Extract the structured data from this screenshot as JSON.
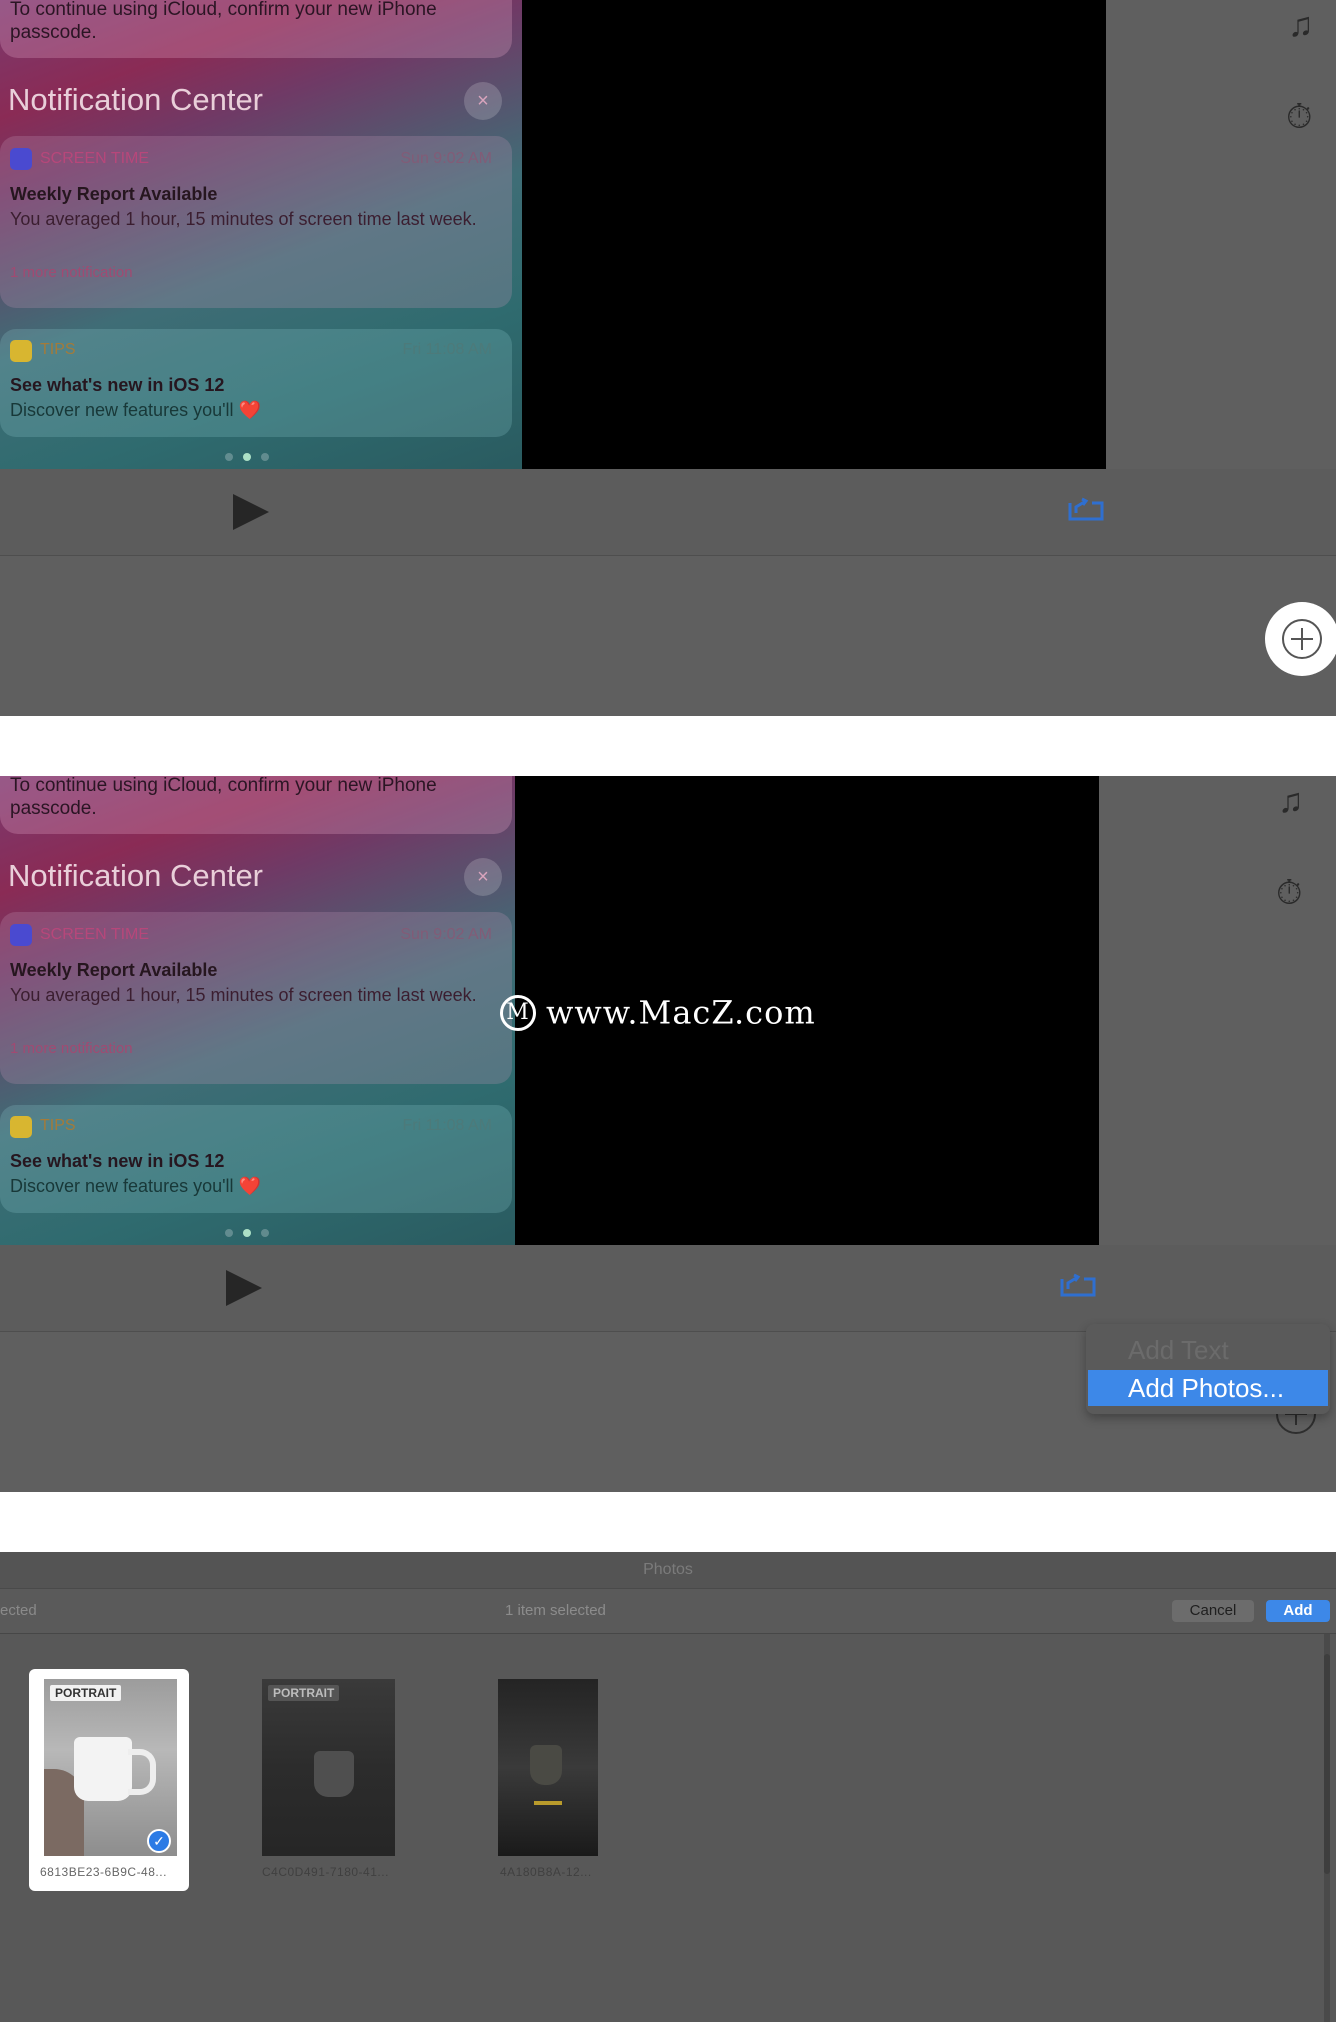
{
  "notification": {
    "top_text": "To continue using iCloud, confirm your new iPhone passcode.",
    "center_title": "Notification Center",
    "close_glyph": "×",
    "cards": [
      {
        "app": "SCREEN TIME",
        "time": "Sun 9:02 AM",
        "title": "Weekly Report Available",
        "body": "You averaged 1 hour, 15 minutes of screen time last week.",
        "more": "1 more notification"
      },
      {
        "app": "TIPS",
        "time": "Fri 11:08 AM",
        "title": "See what's new in iOS 12",
        "body": "Discover new features you'll ❤️"
      }
    ]
  },
  "icons": {
    "music": "♫",
    "timer": "⏱",
    "play": "play-icon",
    "share": "share-icon",
    "add": "add-circle-icon",
    "check": "✓"
  },
  "menu": {
    "add_text": "Add Text",
    "add_photos": "Add Photos..."
  },
  "watermark": {
    "logo_glyph": "M",
    "text": "www.MacZ.com"
  },
  "photos": {
    "window_title": "Photos",
    "left_label": "ected",
    "selection_count": "1 item selected",
    "cancel_label": "Cancel",
    "add_label": "Add",
    "items": [
      {
        "badge": "PORTRAIT",
        "filename": "6813BE23-6B9C-48...",
        "selected": true
      },
      {
        "badge": "PORTRAIT",
        "filename": "C4C0D491-7180-41...",
        "selected": false
      },
      {
        "badge": "",
        "filename": "4A180B8A-12...",
        "selected": false
      }
    ]
  },
  "colors": {
    "accent": "#3d88e8",
    "panel_bg": "#5f5f5f"
  }
}
